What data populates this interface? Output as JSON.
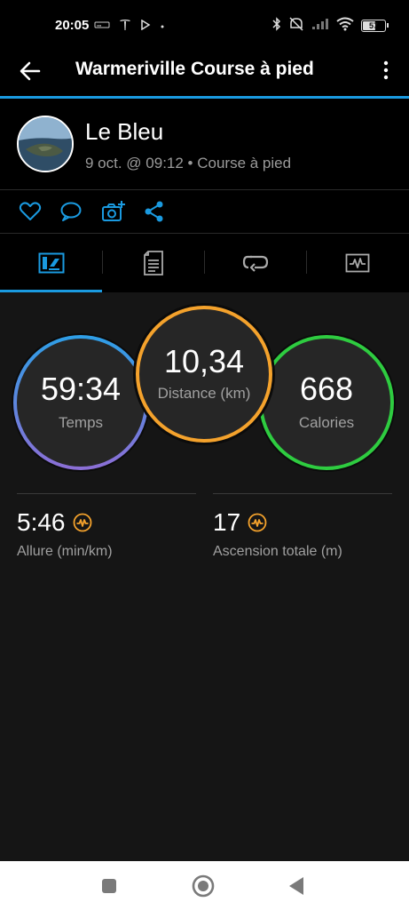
{
  "status_bar": {
    "time": "20:05",
    "battery": "57"
  },
  "app_bar": {
    "title": "Warmeriville Course à pied"
  },
  "activity": {
    "name": "Le Bleu",
    "meta": "9 oct. @ 09:12 • Course à pied"
  },
  "colors": {
    "accent": "#1a9ae0",
    "distance_ring": "#f4a22c",
    "calories_ring": "#2ecc40",
    "time_ring_start": "#2f9ee6",
    "time_ring_end": "#8b6fd6",
    "stat_icon": "#f4a22c"
  },
  "actions": [
    "heart-icon",
    "comment-icon",
    "camera-add-icon",
    "share-icon"
  ],
  "tabs": [
    {
      "name": "summary-tab",
      "selected": true
    },
    {
      "name": "details-tab",
      "selected": false
    },
    {
      "name": "laps-tab",
      "selected": false
    },
    {
      "name": "charts-tab",
      "selected": false
    }
  ],
  "rings": {
    "time": {
      "value": "59:34",
      "label": "Temps"
    },
    "distance": {
      "value": "10,34",
      "label": "Distance (km)"
    },
    "calories": {
      "value": "668",
      "label": "Calories"
    }
  },
  "stats": {
    "pace": {
      "value": "5:46",
      "label": "Allure (min/km)"
    },
    "ascent": {
      "value": "17",
      "label": "Ascension totale (m)"
    }
  }
}
